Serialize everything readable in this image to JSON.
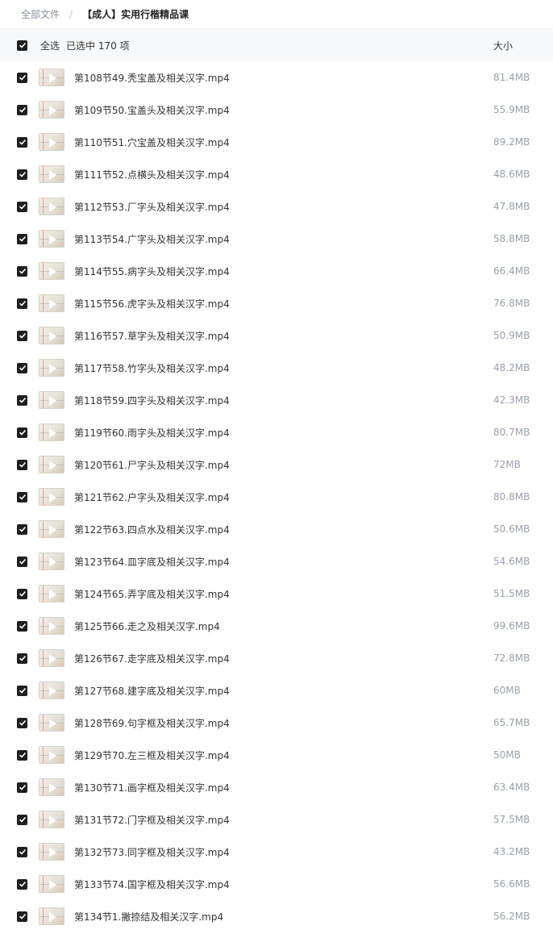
{
  "breadcrumb": {
    "root": "全部文件",
    "separator": "/",
    "current": "【成人】实用行楷精品课"
  },
  "header": {
    "select_all": "全选",
    "selected_text": "已选中  170  项",
    "size_label": "大小"
  },
  "icons": {
    "checkbox": "checked-checkbox-icon",
    "thumbnail": "video-thumbnail-icon"
  },
  "files": [
    {
      "name": "第108节49.秃宝盖及相关汉字.mp4",
      "size": "81.4MB"
    },
    {
      "name": "第109节50.宝盖头及相关汉字.mp4",
      "size": "55.9MB"
    },
    {
      "name": "第110节51.穴宝盖及相关汉字.mp4",
      "size": "89.2MB"
    },
    {
      "name": "第111节52.点横头及相关汉字.mp4",
      "size": "48.6MB"
    },
    {
      "name": "第112节53.厂字头及相关汉字.mp4",
      "size": "47.8MB"
    },
    {
      "name": "第113节54.广字头及相关汉字.mp4",
      "size": "58.8MB"
    },
    {
      "name": "第114节55.病字头及相关汉字.mp4",
      "size": "66.4MB"
    },
    {
      "name": "第115节56.虎字头及相关汉字.mp4",
      "size": "76.8MB"
    },
    {
      "name": "第116节57.草字头及相关汉字.mp4",
      "size": "50.9MB"
    },
    {
      "name": "第117节58.竹字头及相关汉字.mp4",
      "size": "48.2MB"
    },
    {
      "name": "第118节59.四字头及相关汉字.mp4",
      "size": "42.3MB"
    },
    {
      "name": "第119节60.雨字头及相关汉字.mp4",
      "size": "80.7MB"
    },
    {
      "name": "第120节61.尸字头及相关汉字.mp4",
      "size": "72MB"
    },
    {
      "name": "第121节62.户字头及相关汉字.mp4",
      "size": "80.8MB"
    },
    {
      "name": "第122节63.四点水及相关汉字.mp4",
      "size": "50.6MB"
    },
    {
      "name": "第123节64.皿字底及相关汉字.mp4",
      "size": "54.6MB"
    },
    {
      "name": "第124节65.弄字底及相关汉字.mp4",
      "size": "51.5MB"
    },
    {
      "name": "第125节66.走之及相关汉字.mp4",
      "size": "99.6MB"
    },
    {
      "name": "第126节67.走字底及相关汉字.mp4",
      "size": "72.8MB"
    },
    {
      "name": "第127节68.建字底及相关汉字.mp4",
      "size": "60MB"
    },
    {
      "name": "第128节69.句字框及相关汉字.mp4",
      "size": "65.7MB"
    },
    {
      "name": "第129节70.左三框及相关汉字.mp4",
      "size": "50MB"
    },
    {
      "name": "第130节71.画字框及相关汉字.mp4",
      "size": "63.4MB"
    },
    {
      "name": "第131节72.门字框及相关汉字.mp4",
      "size": "57.5MB"
    },
    {
      "name": "第132节73.同字框及相关汉字.mp4",
      "size": "43.2MB"
    },
    {
      "name": "第133节74.国字框及相关汉字.mp4",
      "size": "56.6MB"
    },
    {
      "name": "第134节1.撇捺结及相关汉字.mp4",
      "size": "56.2MB"
    }
  ]
}
